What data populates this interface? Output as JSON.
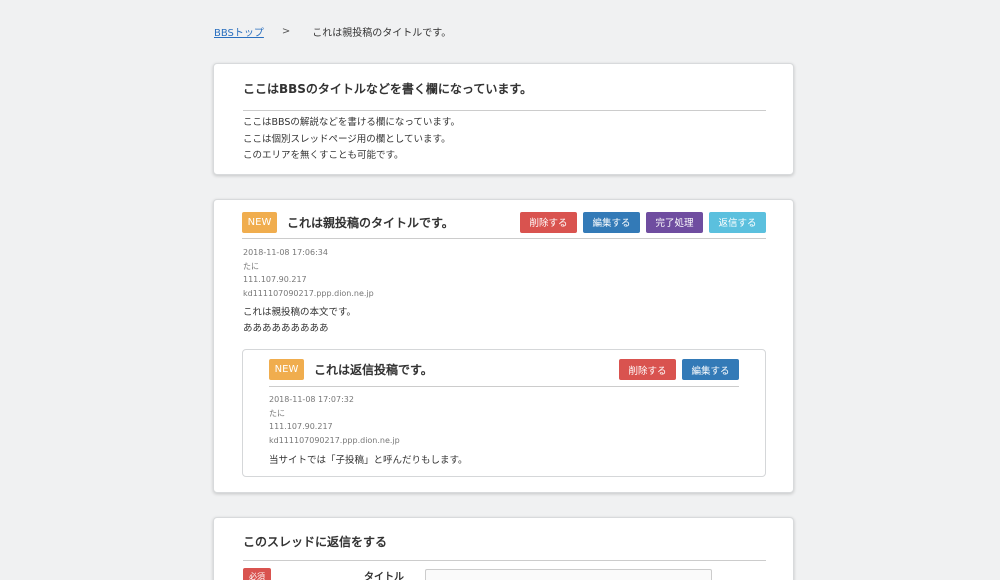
{
  "breadcrumb": {
    "home": "BBSトップ",
    "separator": ">",
    "current": "これは親投稿のタイトルです。"
  },
  "info": {
    "title": "ここはBBSのタイトルなどを書く欄になっています。",
    "lines": [
      "ここはBBSの解説などを書ける欄になっています。",
      "ここは個別スレッドページ用の欄としています。",
      "このエリアを無くすことも可能です。"
    ]
  },
  "parent_post": {
    "badge": "NEW",
    "title": "これは親投稿のタイトルです。",
    "buttons": {
      "delete": "削除する",
      "edit": "編集する",
      "complete": "完了処理",
      "reply": "返信する"
    },
    "datetime": "2018-11-08 17:06:34",
    "author": "たに",
    "ip": "111.107.90.217",
    "host": "kd111107090217.ppp.dion.ne.jp",
    "body_lines": [
      "これは親投稿の本文です。",
      "あああああああああ"
    ]
  },
  "reply_post": {
    "badge": "NEW",
    "title": "これは返信投稿です。",
    "buttons": {
      "delete": "削除する",
      "edit": "編集する"
    },
    "datetime": "2018-11-08 17:07:32",
    "author": "たに",
    "ip": "111.107.90.217",
    "host": "kd111107090217.ppp.dion.ne.jp",
    "body": "当サイトでは「子投稿」と呼んだりもします。"
  },
  "reply_form": {
    "title": "このスレッドに返信をする",
    "required_badge": "必須",
    "title_label": "タイトル",
    "title_value": ""
  },
  "colors": {
    "background": "#f0f1f2",
    "new_badge": "#f0ad4e",
    "delete": "#d9534f",
    "edit": "#337ab7",
    "complete": "#6f4da0",
    "reply": "#5bc0de"
  }
}
